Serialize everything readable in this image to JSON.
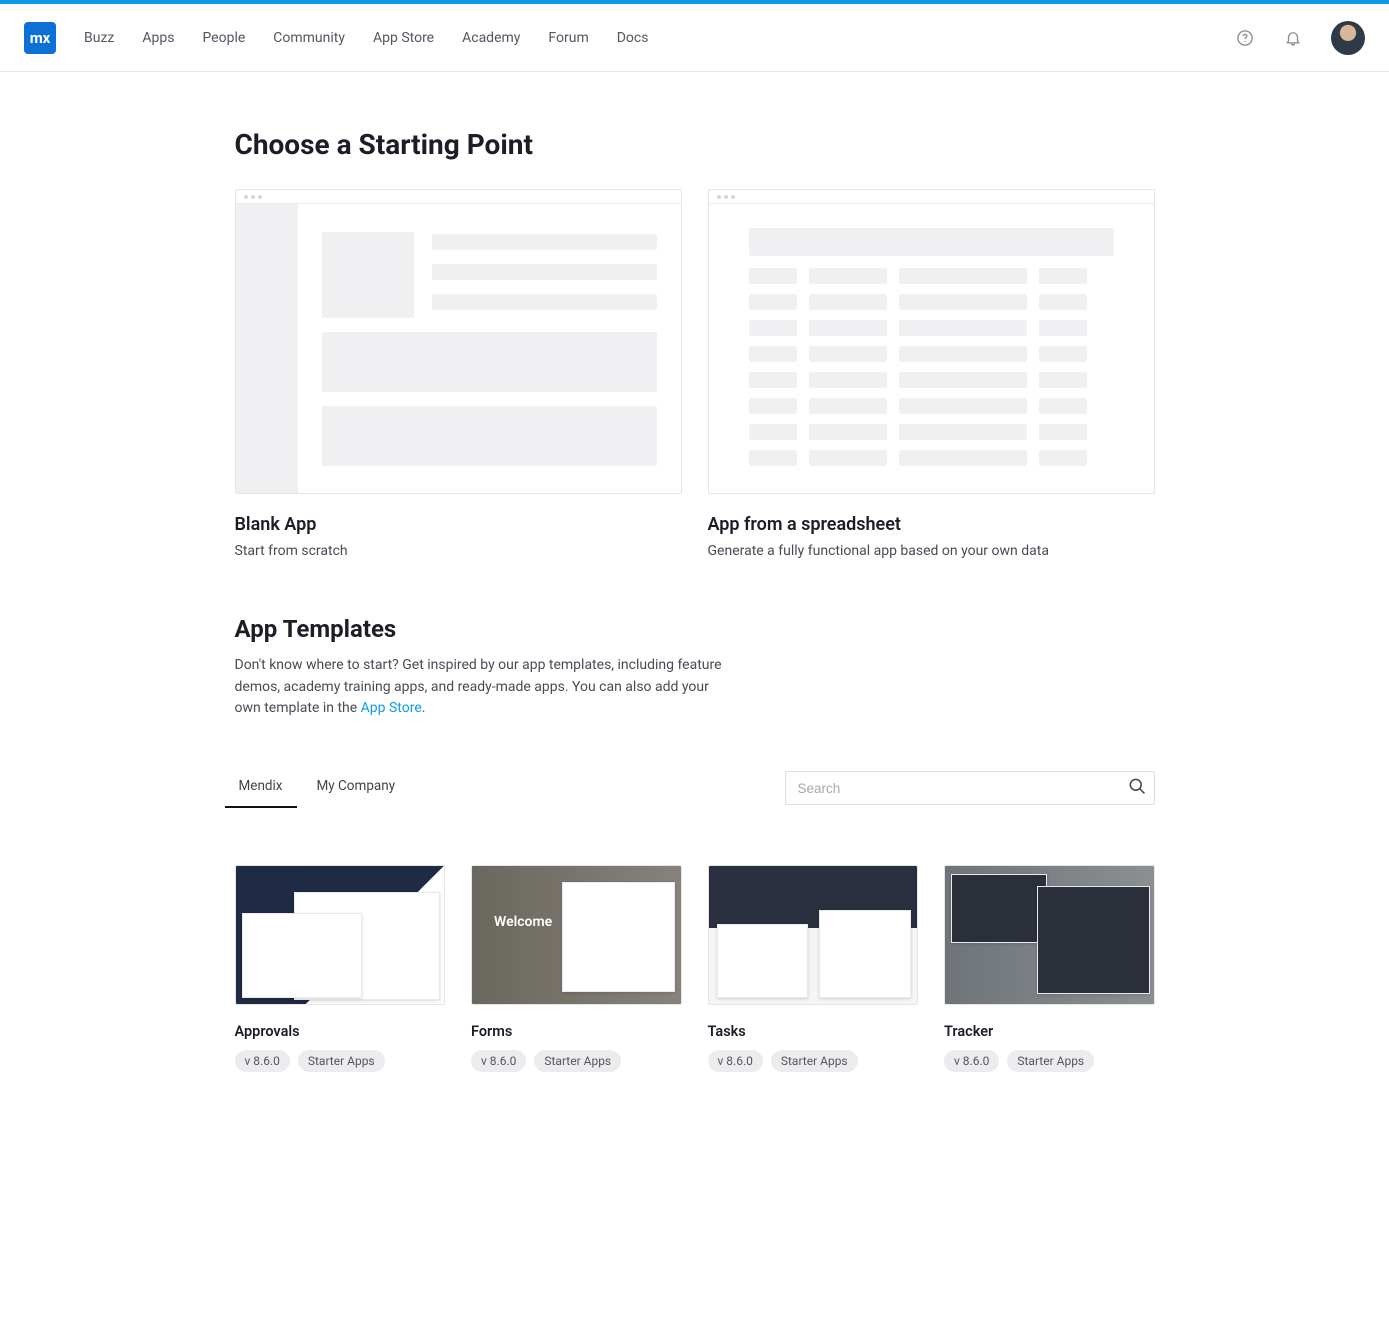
{
  "header": {
    "logo_text": "mx",
    "nav": [
      "Buzz",
      "Apps",
      "People",
      "Community",
      "App Store",
      "Academy",
      "Forum",
      "Docs"
    ]
  },
  "page_title": "Choose a Starting Point",
  "starting_points": {
    "blank": {
      "title": "Blank App",
      "subtitle": "Start from scratch"
    },
    "spreadsheet": {
      "title": "App from a spreadsheet",
      "subtitle": "Generate a fully functional app based on your own data"
    }
  },
  "templates_section": {
    "title": "App Templates",
    "description_pre": "Don't know where to start? Get inspired by our app templates, including feature demos, academy training apps, and ready-made apps. You can also add your own template in the ",
    "link_text": "App Store",
    "description_post": "."
  },
  "tabs": {
    "mendix": "Mendix",
    "my_company": "My Company"
  },
  "search": {
    "placeholder": "Search"
  },
  "templates": [
    {
      "title": "Approvals",
      "version": "v 8.6.0",
      "category": "Starter Apps"
    },
    {
      "title": "Forms",
      "version": "v 8.6.0",
      "category": "Starter Apps"
    },
    {
      "title": "Tasks",
      "version": "v 8.6.0",
      "category": "Starter Apps"
    },
    {
      "title": "Tracker",
      "version": "v 8.6.0",
      "category": "Starter Apps"
    }
  ]
}
